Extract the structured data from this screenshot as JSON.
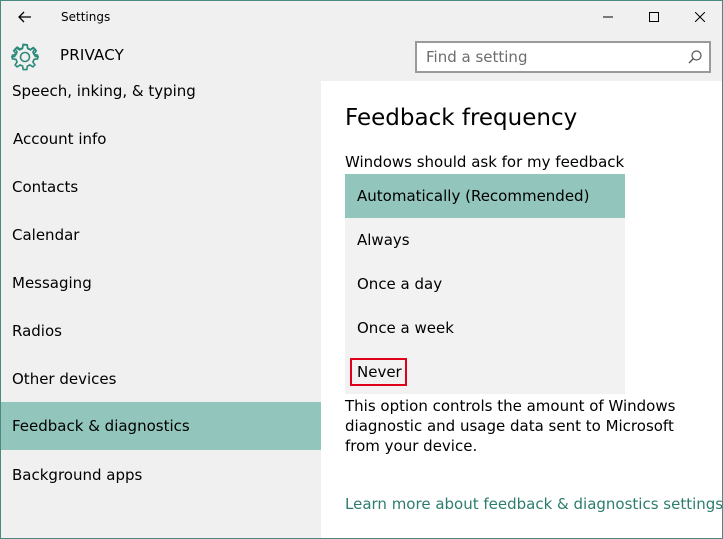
{
  "window": {
    "title": "Settings"
  },
  "header": {
    "title": "PRIVACY",
    "search_placeholder": "Find a setting"
  },
  "sidebar": {
    "items": [
      {
        "label": "Speech, inking, & typing"
      },
      {
        "label": "Account info"
      },
      {
        "label": "Contacts"
      },
      {
        "label": "Calendar"
      },
      {
        "label": "Messaging"
      },
      {
        "label": "Radios"
      },
      {
        "label": "Other devices"
      },
      {
        "label": "Feedback & diagnostics"
      },
      {
        "label": "Background apps"
      }
    ],
    "selected_index": 7
  },
  "main": {
    "heading": "Feedback frequency",
    "frequency_label": "Windows should ask for my feedback",
    "options": [
      {
        "label": "Automatically (Recommended)"
      },
      {
        "label": "Always"
      },
      {
        "label": "Once a day"
      },
      {
        "label": "Once a week"
      },
      {
        "label": "Never"
      }
    ],
    "selected_option_index": 0,
    "description": "This option controls the amount of Windows diagnostic and usage data sent to Microsoft from your device.",
    "learn_more_link": "Learn more about feedback & diagnostics settings"
  },
  "colors": {
    "accent": "#92c6bc",
    "link": "#2c7d6e",
    "annotation": "#e0001a",
    "chrome_bg": "#f0f0f0"
  },
  "icons": {
    "back": "back-arrow-icon",
    "settings": "gear-icon",
    "search": "search-icon",
    "minimize": "minimize-icon",
    "maximize": "maximize-icon",
    "close": "close-icon"
  }
}
